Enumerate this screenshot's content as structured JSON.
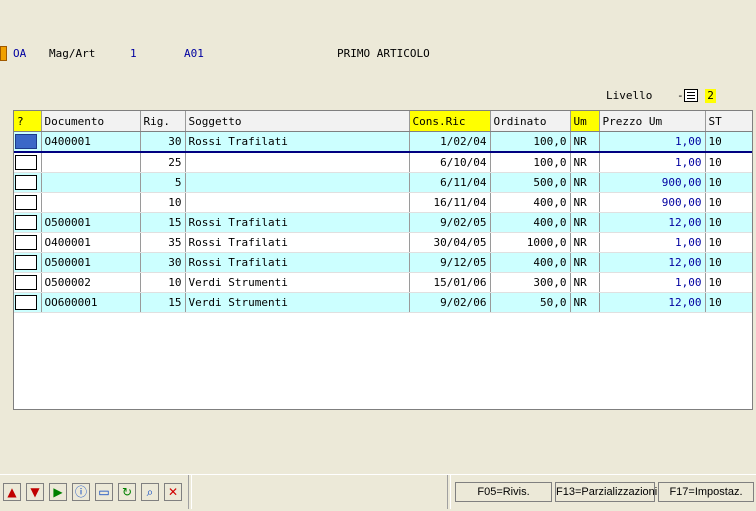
{
  "header": {
    "code": "OA",
    "mag_art_label": "Mag/Art",
    "mag_value": "1",
    "article_code": "A01",
    "article_desc": "PRIMO ARTICOLO",
    "livello_label": "Livello",
    "livello_dash": "-",
    "livello_value": "2"
  },
  "table": {
    "columns": [
      "?",
      "Documento",
      "Rig.",
      "Soggetto",
      "Cons.Ric",
      "Ordinato",
      "Um",
      "Prezzo Um",
      "ST"
    ],
    "rows": [
      {
        "documento": "O400001",
        "rig": "30",
        "soggetto": "Rossi Trafilati",
        "cons": "1/02/04",
        "ordinato": "100,0",
        "um": "NR",
        "prezzo": "1,00",
        "st": "10"
      },
      {
        "documento": "",
        "rig": "25",
        "soggetto": "",
        "cons": "6/10/04",
        "ordinato": "100,0",
        "um": "NR",
        "prezzo": "1,00",
        "st": "10"
      },
      {
        "documento": "",
        "rig": "5",
        "soggetto": "",
        "cons": "6/11/04",
        "ordinato": "500,0",
        "um": "NR",
        "prezzo": "900,00",
        "st": "10"
      },
      {
        "documento": "",
        "rig": "10",
        "soggetto": "",
        "cons": "16/11/04",
        "ordinato": "400,0",
        "um": "NR",
        "prezzo": "900,00",
        "st": "10"
      },
      {
        "documento": "O500001",
        "rig": "15",
        "soggetto": "Rossi Trafilati",
        "cons": "9/02/05",
        "ordinato": "400,0",
        "um": "NR",
        "prezzo": "12,00",
        "st": "10"
      },
      {
        "documento": "O400001",
        "rig": "35",
        "soggetto": "Rossi Trafilati",
        "cons": "30/04/05",
        "ordinato": "1000,0",
        "um": "NR",
        "prezzo": "1,00",
        "st": "10"
      },
      {
        "documento": "O500001",
        "rig": "30",
        "soggetto": "Rossi Trafilati",
        "cons": "9/12/05",
        "ordinato": "400,0",
        "um": "NR",
        "prezzo": "12,00",
        "st": "10"
      },
      {
        "documento": "O500002",
        "rig": "10",
        "soggetto": "Verdi Strumenti",
        "cons": "15/01/06",
        "ordinato": "300,0",
        "um": "NR",
        "prezzo": "1,00",
        "st": "10"
      },
      {
        "documento": "OO600001",
        "rig": "15",
        "soggetto": "Verdi Strumenti",
        "cons": "9/02/06",
        "ordinato": "50,0",
        "um": "NR",
        "prezzo": "12,00",
        "st": "10"
      }
    ]
  },
  "toolbar": {
    "icons": [
      "arrow-up-icon",
      "arrow-down-icon",
      "play-icon",
      "info-icon",
      "open-icon",
      "refresh-icon",
      "search-icon",
      "delete-icon"
    ],
    "glyphs": [
      "▲",
      "▼",
      "▶",
      "ⓘ",
      "▭",
      "↻",
      "⌕",
      "✕"
    ],
    "colors": [
      "#c00000",
      "#c00000",
      "#008000",
      "#0040c0",
      "#0040c0",
      "#008000",
      "#0040c0",
      "#d00000"
    ]
  },
  "function_keys": {
    "f05": "F05=Rivis.",
    "f13": "F13=Parzializzazioni",
    "f17": "F17=Impostaz."
  }
}
